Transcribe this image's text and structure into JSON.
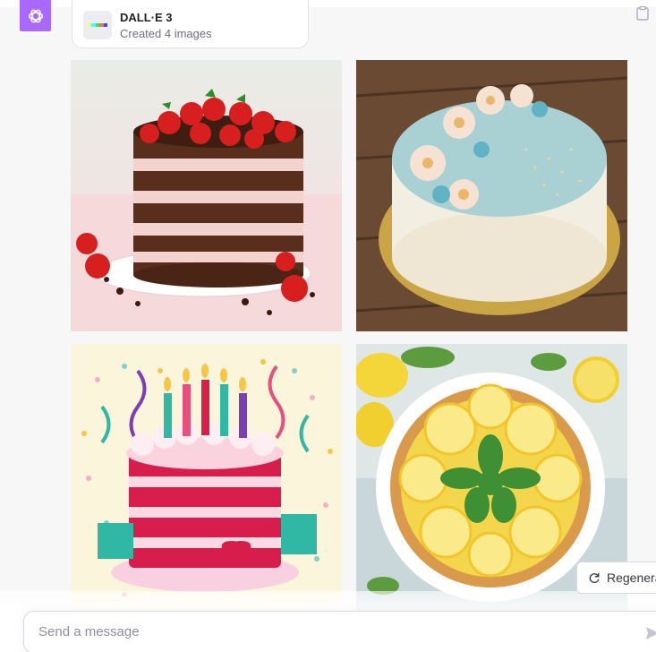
{
  "tool": {
    "name": "DALL·E 3",
    "status": "Created 4 images"
  },
  "images": [
    {
      "icon": "chocolate-strawberry-layer-cake"
    },
    {
      "icon": "blue-floral-frosted-cake"
    },
    {
      "icon": "birthday-cake-with-candles"
    },
    {
      "icon": "lemon-tart"
    }
  ],
  "actions": {
    "regenerate_label": "Regenera"
  },
  "composer": {
    "placeholder": "Send a message"
  },
  "colors": {
    "avatar_bg": "#ab68ff",
    "page_bg": "#f7f7f8",
    "border": "#d9d9e3"
  }
}
